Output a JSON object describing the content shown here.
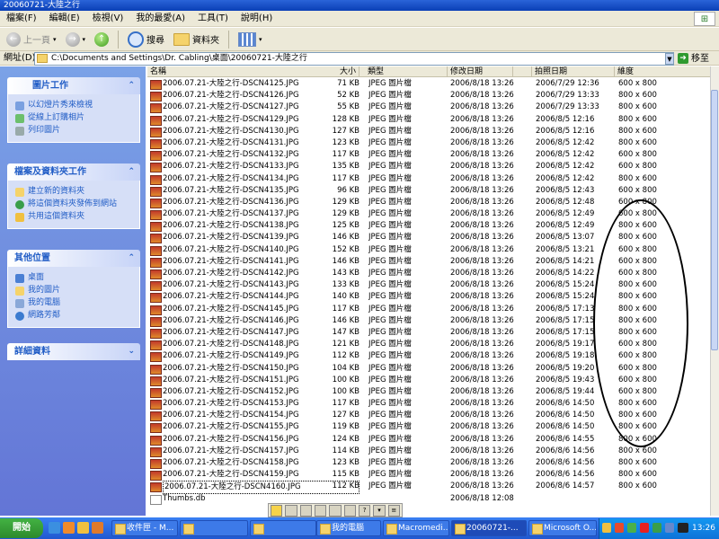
{
  "window": {
    "title": "20060721-大陸之行"
  },
  "menu": [
    "檔案(F)",
    "編輯(E)",
    "檢視(V)",
    "我的最愛(A)",
    "工具(T)",
    "說明(H)"
  ],
  "toolbar": {
    "back": "上一頁",
    "search": "搜尋",
    "folders": "資料夾"
  },
  "address": {
    "label": "網址(D)",
    "value": "C:\\Documents and Settings\\Dr. Cabling\\桌面\\20060721-大陸之行",
    "go": "移至"
  },
  "panels": [
    {
      "title": "圖片工作",
      "chev": "⌃",
      "items": [
        "以幻燈片秀來檢視",
        "從線上訂購相片",
        "列印圖片"
      ]
    },
    {
      "title": "檔案及資料夾工作",
      "chev": "⌃",
      "items": [
        "建立新的資料夾",
        "將這個資料夾發佈到網站",
        "共用這個資料夾"
      ]
    },
    {
      "title": "其他位置",
      "chev": "⌃",
      "items": [
        "桌面",
        "我的圖片",
        "我的電腦",
        "網路芳鄰"
      ]
    },
    {
      "title": "詳細資料",
      "chev": "⌄",
      "items": []
    }
  ],
  "columns": [
    "名稱",
    "大小",
    "類型",
    "修改日期",
    "拍照日期",
    "維度"
  ],
  "files": [
    {
      "name": "2006.07.21-大陸之行-DSCN4125.JPG",
      "size": "71 KB",
      "type": "JPEG 圖片檔",
      "modified": "2006/8/18 13:26",
      "taken": "2006/7/29 12:36",
      "dim": "600 x 800"
    },
    {
      "name": "2006.07.21-大陸之行-DSCN4126.JPG",
      "size": "52 KB",
      "type": "JPEG 圖片檔",
      "modified": "2006/8/18 13:26",
      "taken": "2006/7/29 13:33",
      "dim": "800 x 600"
    },
    {
      "name": "2006.07.21-大陸之行-DSCN4127.JPG",
      "size": "55 KB",
      "type": "JPEG 圖片檔",
      "modified": "2006/8/18 13:26",
      "taken": "2006/7/29 13:33",
      "dim": "800 x 600"
    },
    {
      "name": "2006.07.21-大陸之行-DSCN4129.JPG",
      "size": "128 KB",
      "type": "JPEG 圖片檔",
      "modified": "2006/8/18 13:26",
      "taken": "2006/8/5 12:16",
      "dim": "800 x 600"
    },
    {
      "name": "2006.07.21-大陸之行-DSCN4130.JPG",
      "size": "127 KB",
      "type": "JPEG 圖片檔",
      "modified": "2006/8/18 13:26",
      "taken": "2006/8/5 12:16",
      "dim": "800 x 600"
    },
    {
      "name": "2006.07.21-大陸之行-DSCN4131.JPG",
      "size": "123 KB",
      "type": "JPEG 圖片檔",
      "modified": "2006/8/18 13:26",
      "taken": "2006/8/5 12:42",
      "dim": "800 x 600"
    },
    {
      "name": "2006.07.21-大陸之行-DSCN4132.JPG",
      "size": "117 KB",
      "type": "JPEG 圖片檔",
      "modified": "2006/8/18 13:26",
      "taken": "2006/8/5 12:42",
      "dim": "600 x 800"
    },
    {
      "name": "2006.07.21-大陸之行-DSCN4133.JPG",
      "size": "135 KB",
      "type": "JPEG 圖片檔",
      "modified": "2006/8/18 13:26",
      "taken": "2006/8/5 12:42",
      "dim": "600 x 800"
    },
    {
      "name": "2006.07.21-大陸之行-DSCN4134.JPG",
      "size": "117 KB",
      "type": "JPEG 圖片檔",
      "modified": "2006/8/18 13:26",
      "taken": "2006/8/5 12:42",
      "dim": "800 x 600"
    },
    {
      "name": "2006.07.21-大陸之行-DSCN4135.JPG",
      "size": "96 KB",
      "type": "JPEG 圖片檔",
      "modified": "2006/8/18 13:26",
      "taken": "2006/8/5 12:43",
      "dim": "600 x 800"
    },
    {
      "name": "2006.07.21-大陸之行-DSCN4136.JPG",
      "size": "129 KB",
      "type": "JPEG 圖片檔",
      "modified": "2006/8/18 13:26",
      "taken": "2006/8/5 12:48",
      "dim": "600 x 800"
    },
    {
      "name": "2006.07.21-大陸之行-DSCN4137.JPG",
      "size": "129 KB",
      "type": "JPEG 圖片檔",
      "modified": "2006/8/18 13:26",
      "taken": "2006/8/5 12:49",
      "dim": "600 x 800"
    },
    {
      "name": "2006.07.21-大陸之行-DSCN4138.JPG",
      "size": "125 KB",
      "type": "JPEG 圖片檔",
      "modified": "2006/8/18 13:26",
      "taken": "2006/8/5 12:49",
      "dim": "800 x 600"
    },
    {
      "name": "2006.07.21-大陸之行-DSCN4139.JPG",
      "size": "146 KB",
      "type": "JPEG 圖片檔",
      "modified": "2006/8/18 13:26",
      "taken": "2006/8/5 13:07",
      "dim": "800 x 600"
    },
    {
      "name": "2006.07.21-大陸之行-DSCN4140.JPG",
      "size": "152 KB",
      "type": "JPEG 圖片檔",
      "modified": "2006/8/18 13:26",
      "taken": "2006/8/5 13:21",
      "dim": "600 x 800"
    },
    {
      "name": "2006.07.21-大陸之行-DSCN4141.JPG",
      "size": "146 KB",
      "type": "JPEG 圖片檔",
      "modified": "2006/8/18 13:26",
      "taken": "2006/8/5 14:21",
      "dim": "600 x 800"
    },
    {
      "name": "2006.07.21-大陸之行-DSCN4142.JPG",
      "size": "143 KB",
      "type": "JPEG 圖片檔",
      "modified": "2006/8/18 13:26",
      "taken": "2006/8/5 14:22",
      "dim": "600 x 800"
    },
    {
      "name": "2006.07.21-大陸之行-DSCN4143.JPG",
      "size": "133 KB",
      "type": "JPEG 圖片檔",
      "modified": "2006/8/18 13:26",
      "taken": "2006/8/5 15:24",
      "dim": "800 x 600"
    },
    {
      "name": "2006.07.21-大陸之行-DSCN4144.JPG",
      "size": "140 KB",
      "type": "JPEG 圖片檔",
      "modified": "2006/8/18 13:26",
      "taken": "2006/8/5 15:24",
      "dim": "800 x 600"
    },
    {
      "name": "2006.07.21-大陸之行-DSCN4145.JPG",
      "size": "117 KB",
      "type": "JPEG 圖片檔",
      "modified": "2006/8/18 13:26",
      "taken": "2006/8/5 17:13",
      "dim": "800 x 600"
    },
    {
      "name": "2006.07.21-大陸之行-DSCN4146.JPG",
      "size": "146 KB",
      "type": "JPEG 圖片檔",
      "modified": "2006/8/18 13:26",
      "taken": "2006/8/5 17:15",
      "dim": "800 x 600"
    },
    {
      "name": "2006.07.21-大陸之行-DSCN4147.JPG",
      "size": "147 KB",
      "type": "JPEG 圖片檔",
      "modified": "2006/8/18 13:26",
      "taken": "2006/8/5 17:15",
      "dim": "800 x 600"
    },
    {
      "name": "2006.07.21-大陸之行-DSCN4148.JPG",
      "size": "121 KB",
      "type": "JPEG 圖片檔",
      "modified": "2006/8/18 13:26",
      "taken": "2006/8/5 19:17",
      "dim": "600 x 800"
    },
    {
      "name": "2006.07.21-大陸之行-DSCN4149.JPG",
      "size": "112 KB",
      "type": "JPEG 圖片檔",
      "modified": "2006/8/18 13:26",
      "taken": "2006/8/5 19:18",
      "dim": "600 x 800"
    },
    {
      "name": "2006.07.21-大陸之行-DSCN4150.JPG",
      "size": "104 KB",
      "type": "JPEG 圖片檔",
      "modified": "2006/8/18 13:26",
      "taken": "2006/8/5 19:20",
      "dim": "600 x 800"
    },
    {
      "name": "2006.07.21-大陸之行-DSCN4151.JPG",
      "size": "100 KB",
      "type": "JPEG 圖片檔",
      "modified": "2006/8/18 13:26",
      "taken": "2006/8/5 19:43",
      "dim": "600 x 800"
    },
    {
      "name": "2006.07.21-大陸之行-DSCN4152.JPG",
      "size": "100 KB",
      "type": "JPEG 圖片檔",
      "modified": "2006/8/18 13:26",
      "taken": "2006/8/5 19:44",
      "dim": "600 x 800"
    },
    {
      "name": "2006.07.21-大陸之行-DSCN4153.JPG",
      "size": "117 KB",
      "type": "JPEG 圖片檔",
      "modified": "2006/8/18 13:26",
      "taken": "2006/8/6 14:50",
      "dim": "800 x 600"
    },
    {
      "name": "2006.07.21-大陸之行-DSCN4154.JPG",
      "size": "127 KB",
      "type": "JPEG 圖片檔",
      "modified": "2006/8/18 13:26",
      "taken": "2006/8/6 14:50",
      "dim": "800 x 600"
    },
    {
      "name": "2006.07.21-大陸之行-DSCN4155.JPG",
      "size": "119 KB",
      "type": "JPEG 圖片檔",
      "modified": "2006/8/18 13:26",
      "taken": "2006/8/6 14:50",
      "dim": "800 x 600"
    },
    {
      "name": "2006.07.21-大陸之行-DSCN4156.JPG",
      "size": "124 KB",
      "type": "JPEG 圖片檔",
      "modified": "2006/8/18 13:26",
      "taken": "2006/8/6 14:55",
      "dim": "800 x 600"
    },
    {
      "name": "2006.07.21-大陸之行-DSCN4157.JPG",
      "size": "114 KB",
      "type": "JPEG 圖片檔",
      "modified": "2006/8/18 13:26",
      "taken": "2006/8/6 14:56",
      "dim": "800 x 600"
    },
    {
      "name": "2006.07.21-大陸之行-DSCN4158.JPG",
      "size": "123 KB",
      "type": "JPEG 圖片檔",
      "modified": "2006/8/18 13:26",
      "taken": "2006/8/6 14:56",
      "dim": "800 x 600"
    },
    {
      "name": "2006.07.21-大陸之行-DSCN4159.JPG",
      "size": "115 KB",
      "type": "JPEG 圖片檔",
      "modified": "2006/8/18 13:26",
      "taken": "2006/8/6 14:56",
      "dim": "800 x 600"
    },
    {
      "name": "2006.07.21-大陸之行-DSCN4160.JPG",
      "size": "112 KB",
      "type": "JPEG 圖片檔",
      "modified": "2006/8/18 13:26",
      "taken": "2006/8/6 14:57",
      "dim": "800 x 600"
    },
    {
      "name": "Thumbs.db",
      "size": "",
      "type": "",
      "modified": "2006/8/18 12:08",
      "taken": "",
      "dim": ""
    }
  ],
  "taskbar": {
    "start": "開始",
    "buttons": [
      "收件匣 - M...",
      "",
      "我的電腦",
      "Macromedi...",
      "20060721-...",
      "Microsoft O..."
    ],
    "clock": "13:26"
  },
  "colors": {
    "titlebar": "#0a3fb6",
    "taskbar": "#2058d0",
    "leftpane": "#6375d6",
    "start": "#2d8a2d"
  }
}
